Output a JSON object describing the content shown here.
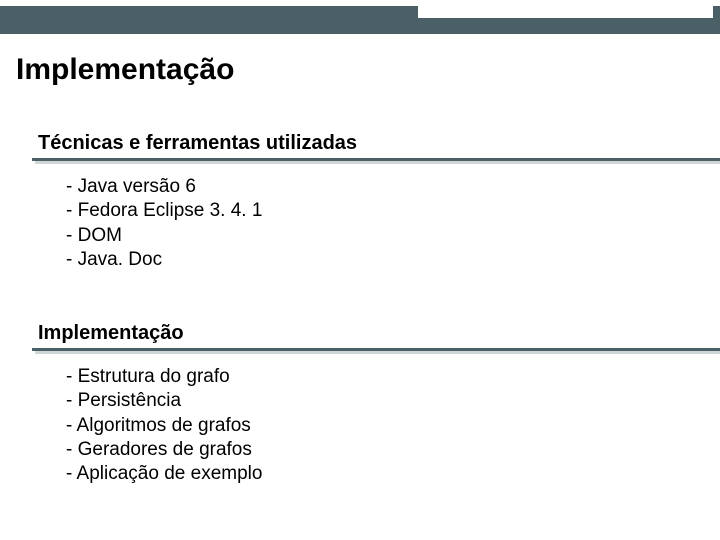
{
  "title": "Implementação",
  "sections": [
    {
      "heading": "Técnicas e ferramentas utilizadas",
      "items": [
        "- Java versão 6",
        "- Fedora Eclipse 3. 4. 1",
        "- DOM",
        "- Java. Doc"
      ]
    },
    {
      "heading": "Implementação",
      "items": [
        "- Estrutura do grafo",
        "- Persistência",
        "- Algoritmos de grafos",
        "- Geradores de grafos",
        "- Aplicação de exemplo"
      ]
    }
  ]
}
